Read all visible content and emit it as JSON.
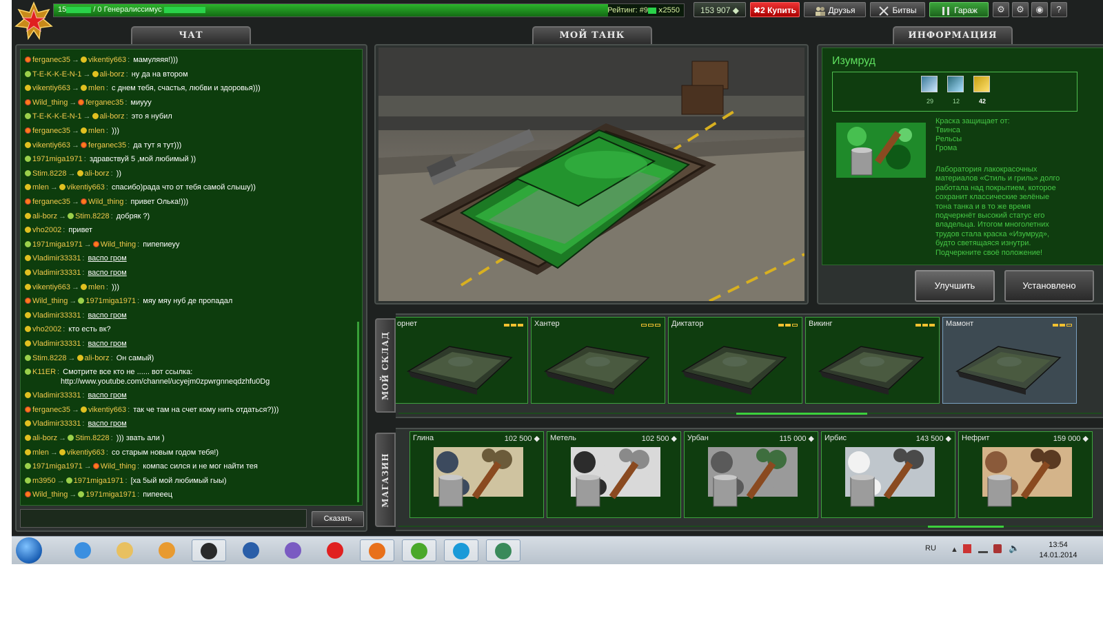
{
  "topbar": {
    "rank_prefix": "15",
    "rank_mid": "/ 0  Генералиссимус",
    "rating": "Рейтинг: #9",
    "rating_delta": "ⅹ2550",
    "crystals": "153 907",
    "buy_multiplier": "2",
    "buy": "Купить",
    "friends": "Друзья",
    "battles": "Битвы",
    "garage": "Гараж",
    "help": "?",
    "progress_fraction": 0.88
  },
  "tabs": {
    "chat": "ЧАТ",
    "my_tank": "МОЙ ТАНК",
    "info": "ИНФОРМАЦИЯ"
  },
  "chat": {
    "messages": [
      {
        "r1": "o",
        "from": "ferganec35",
        "r2": "y",
        "to": "vikentiy663",
        "text": "мамуляяя!)))"
      },
      {
        "r1": "g",
        "from": "T-E-K-K-E-N-1",
        "r2": "y",
        "to": "ali-borz",
        "text": "ну да на втором"
      },
      {
        "r1": "y",
        "from": "vikentiy663",
        "r2": "y",
        "to": "mlen",
        "text": "с днем тебя, счастья, любви и здоровья)))"
      },
      {
        "r1": "o",
        "from": "Wild_thing",
        "r2": "o",
        "to": "ferganec35",
        "text": "миууу"
      },
      {
        "r1": "g",
        "from": "T-E-K-K-E-N-1",
        "r2": "y",
        "to": "ali-borz",
        "text": "это я нубил"
      },
      {
        "r1": "o",
        "from": "ferganec35",
        "r2": "y",
        "to": "mlen",
        "text": ")))"
      },
      {
        "r1": "y",
        "from": "vikentiy663",
        "r2": "o",
        "to": "ferganec35",
        "text": "да тут я тут)))"
      },
      {
        "r1": "g",
        "from": "1971miga1971",
        "r2": "",
        "to": "",
        "text": "здравствуй 5 ,мой любимый ))"
      },
      {
        "r1": "g",
        "from": "Stim.8228",
        "r2": "y",
        "to": "ali-borz",
        "text": "))"
      },
      {
        "r1": "y",
        "from": "mlen",
        "r2": "y",
        "to": "vikentiy663",
        "text": "спасибо)рада что от тебя самой слышу))"
      },
      {
        "r1": "o",
        "from": "ferganec35",
        "r2": "o",
        "to": "Wild_thing",
        "text": "привет Олька!)))"
      },
      {
        "r1": "y",
        "from": "ali-borz",
        "r2": "g",
        "to": "Stim.8228",
        "text": "добряк ?)"
      },
      {
        "r1": "y",
        "from": "vho2002",
        "r2": "",
        "to": "",
        "text": "привет"
      },
      {
        "r1": "g",
        "from": "1971miga1971",
        "r2": "o",
        "to": "Wild_thing",
        "text": "пипепиеуу"
      },
      {
        "r1": "y",
        "from": "Vladimir33331",
        "r2": "",
        "to": "",
        "text": "васпо гром",
        "link": true
      },
      {
        "r1": "y",
        "from": "Vladimir33331",
        "r2": "",
        "to": "",
        "text": "васпо гром",
        "link": true
      },
      {
        "r1": "y",
        "from": "vikentiy663",
        "r2": "y",
        "to": "mlen",
        "text": ")))"
      },
      {
        "r1": "o",
        "from": "Wild_thing",
        "r2": "g",
        "to": "1971miga1971",
        "text": "мяу мяу нуб де пропадал"
      },
      {
        "r1": "y",
        "from": "Vladimir33331",
        "r2": "",
        "to": "",
        "text": "васпо гром",
        "link": true
      },
      {
        "r1": "y",
        "from": "vho2002",
        "r2": "",
        "to": "",
        "text": "кто есть вк?"
      },
      {
        "r1": "y",
        "from": "Vladimir33331",
        "r2": "",
        "to": "",
        "text": "васпо гром",
        "link": true
      },
      {
        "r1": "g",
        "from": "Stim.8228",
        "r2": "y",
        "to": "ali-borz",
        "text": "Он самый)"
      },
      {
        "r1": "g",
        "from": "K11ER",
        "r2": "",
        "to": "",
        "text": "Смотрите все кто не ...... вот ссылка:",
        "text2": "http://www.youtube.com/channel/ucyejm0zpwrgnneqdzhfu0Dg"
      },
      {
        "r1": "y",
        "from": "Vladimir33331",
        "r2": "",
        "to": "",
        "text": "васпо гром",
        "link": true
      },
      {
        "r1": "o",
        "from": "ferganec35",
        "r2": "y",
        "to": "vikentiy663",
        "text": "так че там на счет кому нить отдаться?)))"
      },
      {
        "r1": "y",
        "from": "Vladimir33331",
        "r2": "",
        "to": "",
        "text": "васпо гром",
        "link": true
      },
      {
        "r1": "y",
        "from": "ali-borz",
        "r2": "g",
        "to": "Stim.8228",
        "text": "))) звать али )"
      },
      {
        "r1": "y",
        "from": "mlen",
        "r2": "y",
        "to": "vikentiy663",
        "text": "со старым новым годом тебя!)"
      },
      {
        "r1": "g",
        "from": "1971miga1971",
        "r2": "o",
        "to": "Wild_thing",
        "text": "компас сился и не мог найти тея"
      },
      {
        "r1": "g",
        "from": "m3950",
        "r2": "g",
        "to": "1971miga1971",
        "text": "[ха 5ый мой любимый гыы)"
      },
      {
        "r1": "o",
        "from": "Wild_thing",
        "r2": "g",
        "to": "1971miga1971",
        "text": "пипееец"
      }
    ],
    "say_button": "Сказать",
    "input_value": ""
  },
  "info": {
    "title": "Изумруд",
    "props": [
      {
        "icon": "railgun-protection-icon",
        "value": "29"
      },
      {
        "icon": "twins-protection-icon",
        "value": "12"
      },
      {
        "icon": "thunder-protection-icon",
        "value": "42"
      }
    ],
    "protects_heading": "Краска защищает от:",
    "protects": [
      "Твинса",
      "Рельсы",
      "Грома"
    ],
    "description": "Лаборатория лакокрасочных материалов «Стиль и гриль» долго работала над покрытием, которое сохранит классические зелёные тона танка и в то же время подчеркнёт высокий статус его владельца. Итогом многолетних трудов стала краска «Изумруд», будто светящаяся изнутри. Подчеркните своё положение!",
    "upgrade": "Улучшить",
    "installed": "Установлено"
  },
  "warehouse": {
    "label": "МОЙ СКЛАД",
    "items": [
      {
        "name": "орнет",
        "level": 3,
        "max": 3
      },
      {
        "name": "Хантер",
        "level": 0,
        "max": 3
      },
      {
        "name": "Диктатор",
        "level": 2,
        "max": 3
      },
      {
        "name": "Викинг",
        "level": 3,
        "max": 3
      },
      {
        "name": "Мамонт",
        "level": 2,
        "max": 3,
        "selected": true
      }
    ]
  },
  "shop": {
    "label": "МАГАЗИН",
    "items": [
      {
        "name": "Глина",
        "price": "102 500",
        "colors": [
          "#3c4a5e",
          "#cfc3a0",
          "#6b5b3a"
        ]
      },
      {
        "name": "Метель",
        "price": "102 500",
        "colors": [
          "#2c2c2c",
          "#d9d9d9",
          "#8a8a8a"
        ]
      },
      {
        "name": "Урбан",
        "price": "115 000",
        "colors": [
          "#5a5a5a",
          "#9a9a9a",
          "#3e6e3e"
        ]
      },
      {
        "name": "Ирбис",
        "price": "143 500",
        "colors": [
          "#f2f2f2",
          "#bfc6cc",
          "#4a4a4a"
        ]
      },
      {
        "name": "Нефрит",
        "price": "159 000",
        "colors": [
          "#8a5a3a",
          "#d4b48a",
          "#5a3a22"
        ]
      }
    ]
  },
  "taskbar": {
    "apps": [
      {
        "icon": "internet-explorer-icon",
        "active": false
      },
      {
        "icon": "file-explorer-icon",
        "active": false
      },
      {
        "icon": "media-player-icon",
        "active": false
      },
      {
        "icon": "hp-icon",
        "active": true
      },
      {
        "icon": "checkmark-app-icon",
        "active": false
      },
      {
        "icon": "visual-studio-icon",
        "active": false
      },
      {
        "icon": "yandex-icon",
        "active": false
      },
      {
        "icon": "firefox-icon",
        "active": true
      },
      {
        "icon": "utorrent-icon",
        "active": true
      },
      {
        "icon": "skype-icon",
        "active": true
      },
      {
        "icon": "network-app-icon",
        "active": true
      }
    ],
    "lang": "RU",
    "time": "13:54",
    "date": "14.01.2014"
  }
}
